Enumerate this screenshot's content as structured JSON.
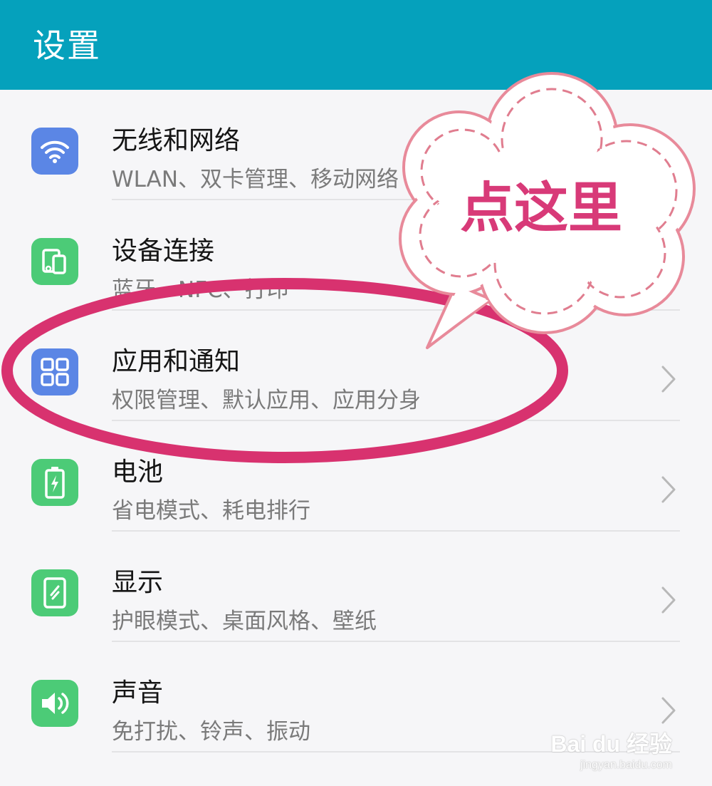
{
  "header": {
    "title": "设置"
  },
  "items": [
    {
      "title": "无线和网络",
      "subtitle": "WLAN、双卡管理、移动网络",
      "icon": "wifi-icon",
      "color": "#5b86e5"
    },
    {
      "title": "设备连接",
      "subtitle": "蓝牙、NFC、打印",
      "icon": "device-connection-icon",
      "color": "#4ccb77"
    },
    {
      "title": "应用和通知",
      "subtitle": "权限管理、默认应用、应用分身",
      "icon": "apps-grid-icon",
      "color": "#5b86e5"
    },
    {
      "title": "电池",
      "subtitle": "省电模式、耗电排行",
      "icon": "battery-icon",
      "color": "#4ccb77"
    },
    {
      "title": "显示",
      "subtitle": "护眼模式、桌面风格、壁纸",
      "icon": "display-icon",
      "color": "#4ccb77"
    },
    {
      "title": "声音",
      "subtitle": "免打扰、铃声、振动",
      "icon": "speaker-icon",
      "color": "#4ccb77"
    }
  ],
  "annotation": {
    "callout_text": "点这里",
    "accent_color": "#d83a78"
  },
  "watermark": {
    "main": "Bai du 经验",
    "sub": "jingyan.baidu.com"
  }
}
